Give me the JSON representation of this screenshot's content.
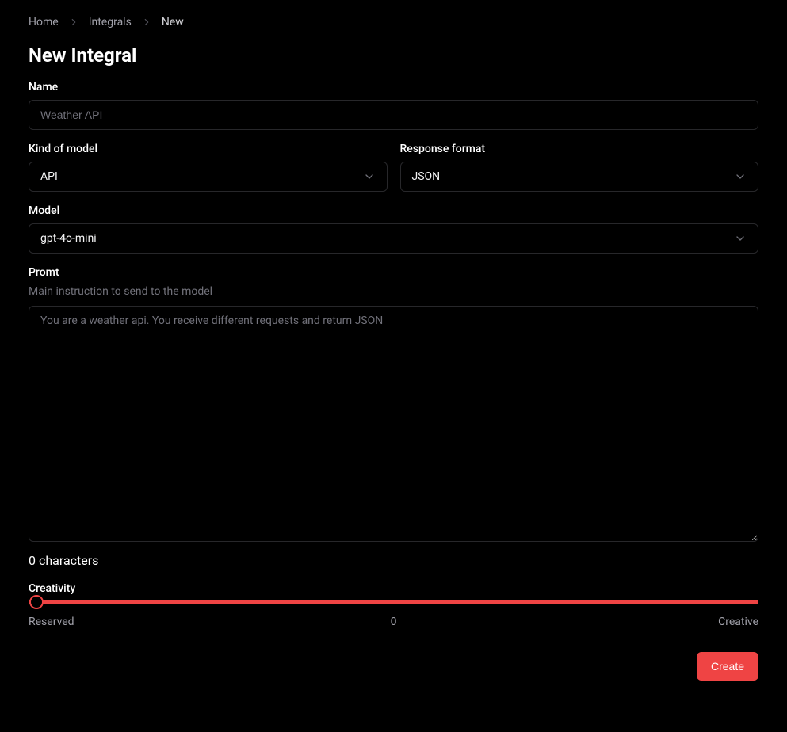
{
  "breadcrumb": {
    "items": [
      "Home",
      "Integrals",
      "New"
    ]
  },
  "page_title": "New Integral",
  "form": {
    "name": {
      "label": "Name",
      "placeholder": "Weather API",
      "value": ""
    },
    "kind": {
      "label": "Kind of model",
      "value": "API"
    },
    "response_format": {
      "label": "Response format",
      "value": "JSON"
    },
    "model": {
      "label": "Model",
      "value": "gpt-4o-mini"
    },
    "prompt": {
      "label": "Promt",
      "sublabel": "Main instruction to send to the model",
      "placeholder": "You are a weather api. You receive different requests and return JSON",
      "value": ""
    },
    "char_count": "0 characters",
    "creativity": {
      "label": "Creativity",
      "value": 0,
      "left_label": "Reserved",
      "center_label": "0",
      "right_label": "Creative"
    }
  },
  "actions": {
    "create": "Create"
  }
}
